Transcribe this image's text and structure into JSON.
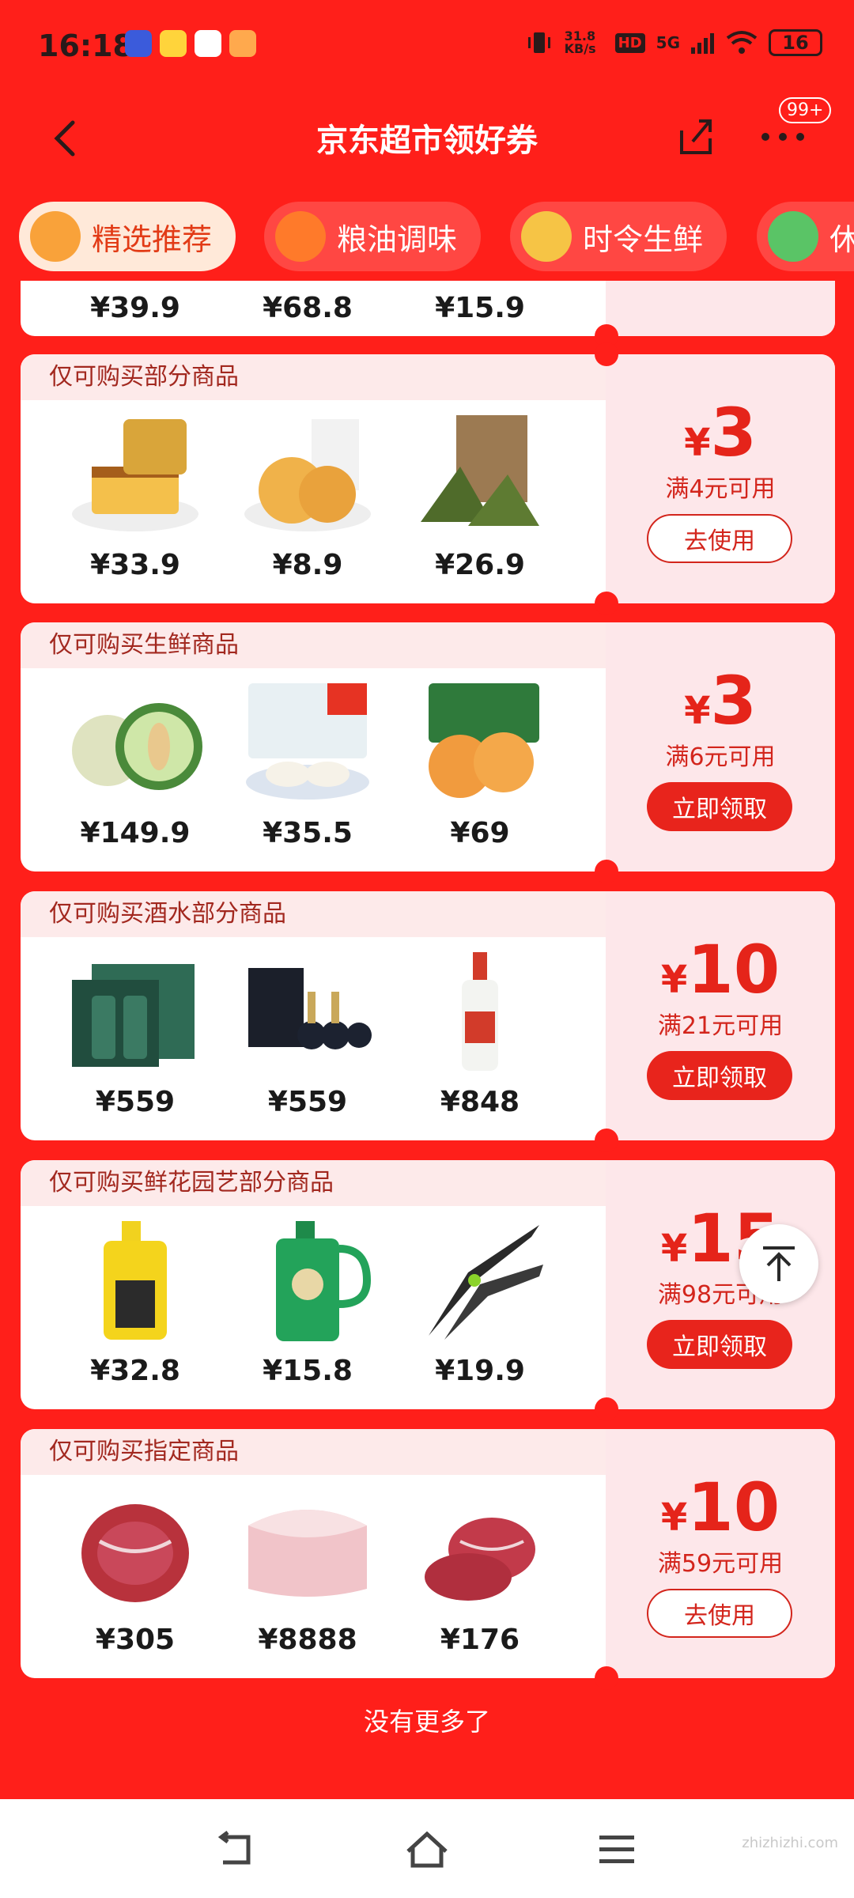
{
  "status_bar": {
    "time": "16:18",
    "net_speed": "31.8 KB/s",
    "hd": "HD",
    "signal": "5G",
    "battery": "16"
  },
  "header": {
    "title": "京东超市领好券",
    "badge": "99+"
  },
  "tabs": [
    {
      "label": "精选推荐",
      "active": true
    },
    {
      "label": "粮油调味"
    },
    {
      "label": "时令生鲜"
    },
    {
      "label": "休"
    }
  ],
  "cards": [
    {
      "condition": "",
      "prices": [
        "¥39.9",
        "¥68.8",
        "¥15.9"
      ]
    },
    {
      "condition": "仅可购买部分商品",
      "prices": [
        "¥33.9",
        "¥8.9",
        "¥26.9"
      ],
      "amount": "3",
      "threshold": "满4元可用",
      "button": "去使用",
      "button_style": "outline"
    },
    {
      "condition": "仅可购买生鲜商品",
      "prices": [
        "¥149.9",
        "¥35.5",
        "¥69"
      ],
      "amount": "3",
      "threshold": "满6元可用",
      "button": "立即领取",
      "button_style": "solid"
    },
    {
      "condition": "仅可购买酒水部分商品",
      "prices": [
        "¥559",
        "¥559",
        "¥848"
      ],
      "amount": "10",
      "threshold": "满21元可用",
      "button": "立即领取",
      "button_style": "solid"
    },
    {
      "condition": "仅可购买鲜花园艺部分商品",
      "prices": [
        "¥32.8",
        "¥15.8",
        "¥19.9"
      ],
      "amount": "15",
      "threshold": "满98元可用",
      "button": "立即领取",
      "button_style": "solid"
    },
    {
      "condition": "仅可购买指定商品",
      "prices": [
        "¥305",
        "¥8888",
        "¥176"
      ],
      "amount": "10",
      "threshold": "满59元可用",
      "button": "去使用",
      "button_style": "outline"
    }
  ],
  "footer": "没有更多了",
  "yen_symbol": "¥",
  "watermark": "zhizhizhi.com",
  "colors": {
    "brand_red": "#ff1f1a",
    "coupon_red": "#e5241a"
  }
}
